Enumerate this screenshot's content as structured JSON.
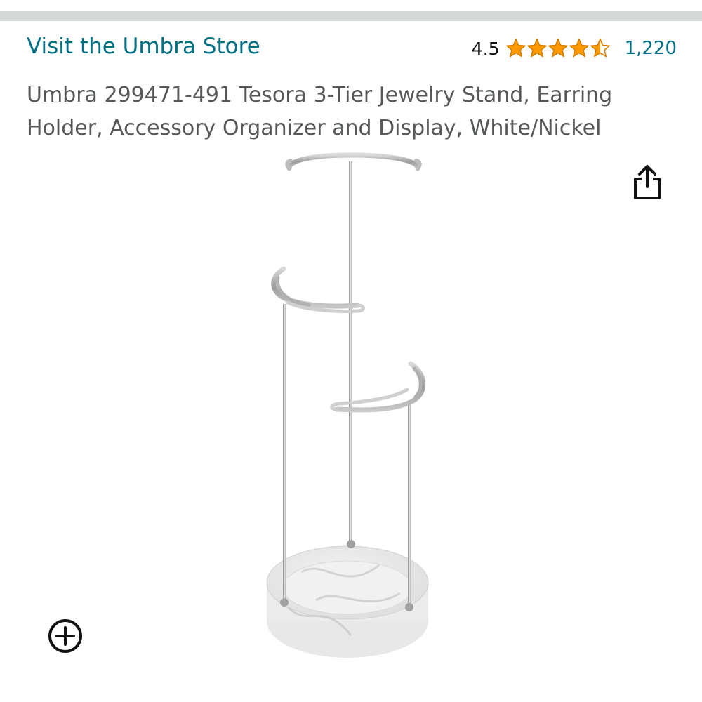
{
  "store": {
    "link_text": "Visit the Umbra Store"
  },
  "rating": {
    "value_text": "4.5",
    "stars_out_of_5": 4.5,
    "review_count": "1,220",
    "star_color": "#ff9900"
  },
  "product": {
    "title": "Umbra 299471-491 Tesora 3-Tier Jewelry Stand, Earring Holder, Accessory Organizer and Display, White/Nickel"
  },
  "icons": {
    "share": "share-icon",
    "zoom": "zoom-in-plus-icon"
  },
  "colors": {
    "link": "#007185",
    "text": "#565959",
    "divider": "#d5d9d9"
  }
}
